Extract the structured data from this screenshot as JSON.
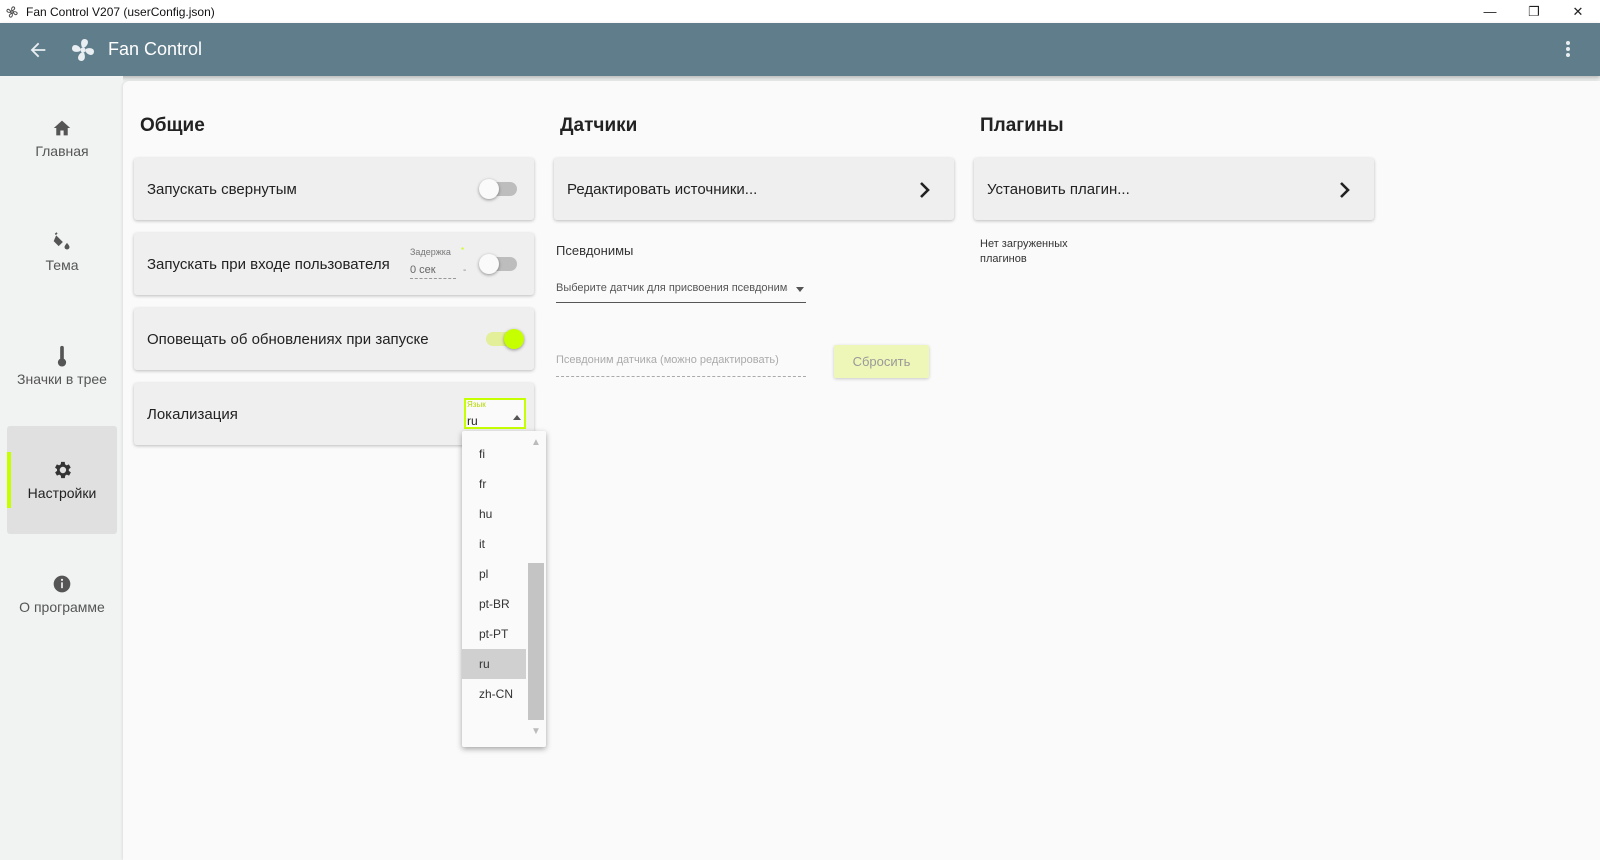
{
  "window": {
    "title": "Fan Control V207 (userConfig.json)",
    "minimize": "—",
    "maximize": "❐",
    "close": "✕"
  },
  "appbar": {
    "title": "Fan Control"
  },
  "sidebar": {
    "items": [
      {
        "label": "Главная",
        "icon": "home-icon"
      },
      {
        "label": "Тема",
        "icon": "paint-bucket-icon"
      },
      {
        "label": "Значки в трее",
        "icon": "thermometer-icon"
      },
      {
        "label": "Настройки",
        "icon": "gear-icon",
        "active": true
      },
      {
        "label": "О программе",
        "icon": "info-icon"
      }
    ]
  },
  "general": {
    "title": "Общие",
    "start_minimized": {
      "label": "Запускать свернутым",
      "enabled": false
    },
    "start_on_login": {
      "label": "Запускать при входе пользователя",
      "enabled": false,
      "delay_label": "Задержка",
      "delay_value": "0 сек",
      "delay_required": "*",
      "delay_dash": "-"
    },
    "notify_updates": {
      "label": "Оповещать об обновлениях при запуске",
      "enabled": true
    },
    "localization": {
      "label": "Локализация",
      "field_label": "Язык",
      "value": "ru"
    }
  },
  "language_dropdown": {
    "options": [
      "fi",
      "fr",
      "hu",
      "it",
      "pl",
      "pt-BR",
      "pt-PT",
      "ru",
      "zh-CN"
    ],
    "selected": "ru"
  },
  "sensors": {
    "title": "Датчики",
    "edit_sources": "Редактировать источники...",
    "aliases_label": "Псевдонимы",
    "select_placeholder": "Выберите датчик для присвоения псевдонима",
    "alias_placeholder": "Псевдоним датчика (можно редактировать)",
    "reset_button": "Сбросить"
  },
  "plugins": {
    "title": "Плагины",
    "install_plugin": "Установить плагин...",
    "no_plugins": "Нет загруженных плагинов"
  },
  "colors": {
    "appbar": "#607d8b",
    "accent": "#c6ff00"
  }
}
